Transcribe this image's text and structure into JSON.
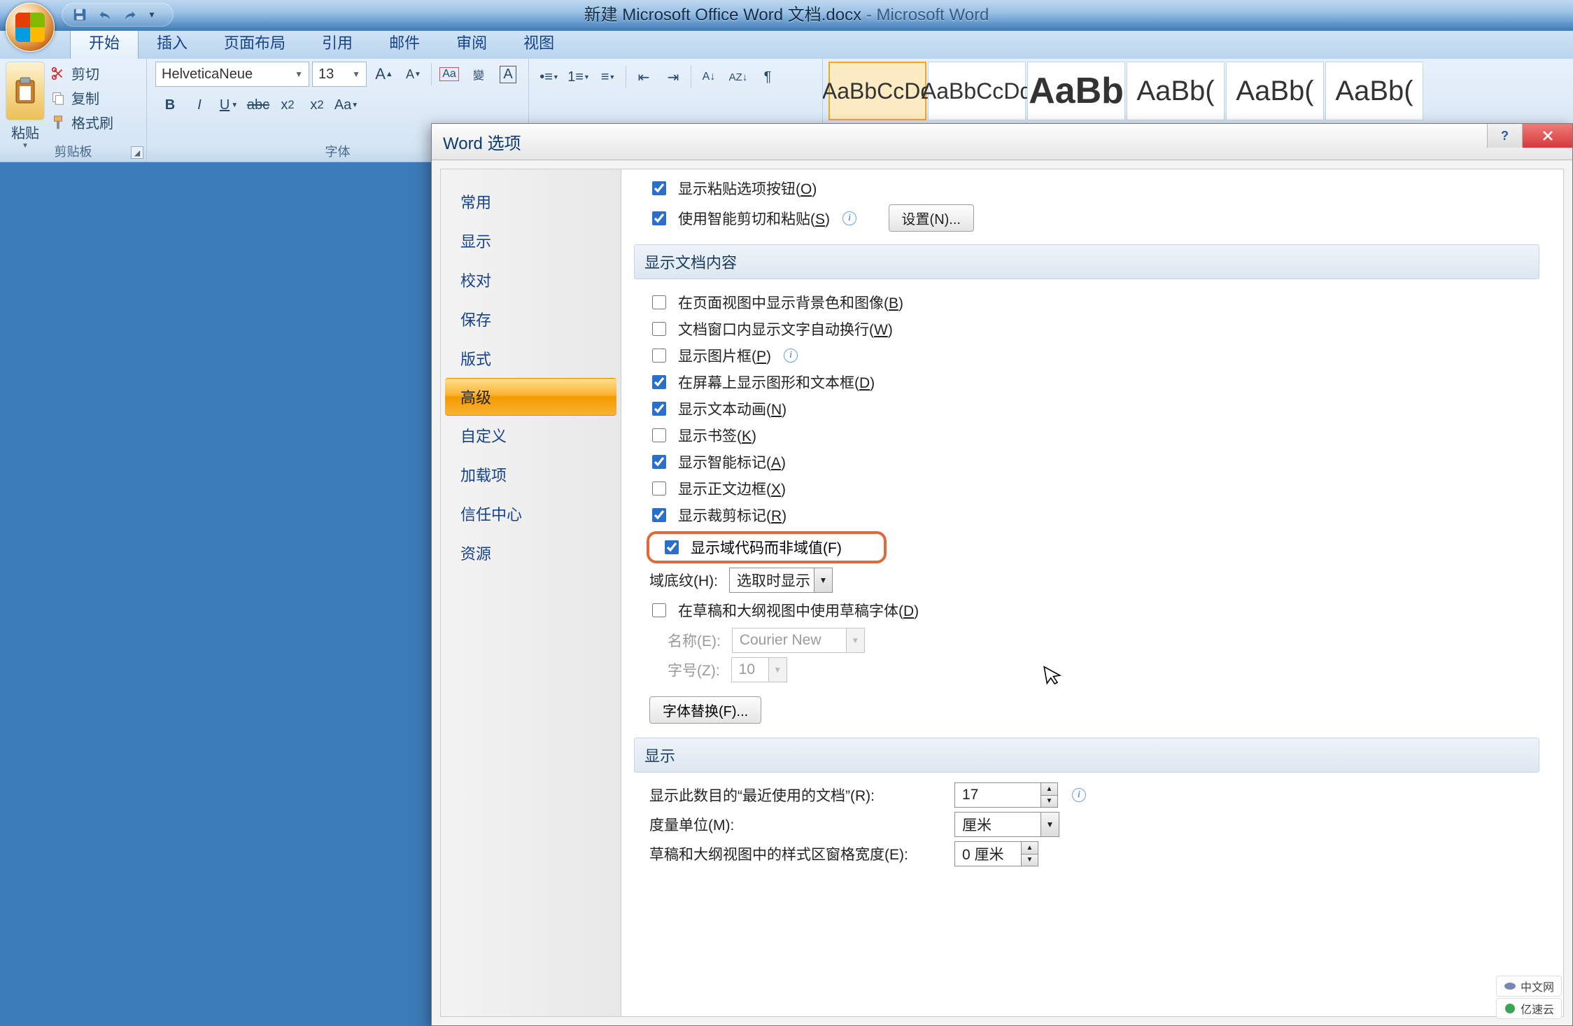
{
  "titlebar": {
    "filename": "新建 Microsoft Office Word 文档.docx",
    "appname": "Microsoft Word"
  },
  "tabs": [
    "开始",
    "插入",
    "页面布局",
    "引用",
    "邮件",
    "审阅",
    "视图"
  ],
  "active_tab": 0,
  "ribbon": {
    "clipboard": {
      "group_label": "剪贴板",
      "paste": "粘贴",
      "cut": "剪切",
      "copy": "复制",
      "format_painter": "格式刷"
    },
    "font": {
      "group_label": "字体",
      "font_name": "HelveticaNeue",
      "font_size": "13"
    },
    "styles": [
      "AaBbCcDd",
      "AaBbCcDd",
      "AaBb",
      "AaBb(",
      "AaBb(",
      "AaBb("
    ]
  },
  "dialog": {
    "title": "Word 选项",
    "nav": [
      "常用",
      "显示",
      "校对",
      "保存",
      "版式",
      "高级",
      "自定义",
      "加载项",
      "信任中心",
      "资源"
    ],
    "nav_selected": 5,
    "opts": {
      "paste_options": {
        "label_pre": "显示粘贴选项按钮(",
        "u": "O",
        "label_post": ")",
        "checked": true
      },
      "smart_cutpaste": {
        "label_pre": "使用智能剪切和粘贴(",
        "u": "S",
        "label_post": ")",
        "checked": true
      },
      "settings_btn": "设置(N)...",
      "section_doc": "显示文档内容",
      "bg_img": {
        "label_pre": "在页面视图中显示背景色和图像(",
        "u": "B",
        "label_post": ")",
        "checked": false
      },
      "wrap": {
        "label_pre": "文档窗口内显示文字自动换行(",
        "u": "W",
        "label_post": ")",
        "checked": false
      },
      "pic_frame": {
        "label_pre": "显示图片框(",
        "u": "P",
        "label_post": ")",
        "checked": false,
        "info": true
      },
      "draw_text": {
        "label_pre": "在屏幕上显示图形和文本框(",
        "u": "D",
        "label_post": ")",
        "checked": true
      },
      "text_anim": {
        "label_pre": "显示文本动画(",
        "u": "N",
        "label_post": ")",
        "checked": true
      },
      "bookmark": {
        "label_pre": "显示书签(",
        "u": "K",
        "label_post": ")",
        "checked": false
      },
      "smart_tag": {
        "label_pre": "显示智能标记(",
        "u": "A",
        "label_post": ")",
        "checked": true
      },
      "text_border": {
        "label_pre": "显示正文边框(",
        "u": "X",
        "label_post": ")",
        "checked": false
      },
      "crop_marks": {
        "label_pre": "显示裁剪标记(",
        "u": "R",
        "label_post": ")",
        "checked": true
      },
      "field_codes": {
        "label_pre": "显示域代码而非域值(",
        "u": "F",
        "label_post": ")",
        "checked": true
      },
      "field_shading_label": "域底纹(H):",
      "field_shading_value": "选取时显示",
      "draft_font": {
        "label_pre": "在草稿和大纲视图中使用草稿字体(",
        "u": "D",
        "label_post": ")",
        "checked": false
      },
      "draft_name_label": "名称(E):",
      "draft_name_value": "Courier New",
      "draft_size_label": "字号(Z):",
      "draft_size_value": "10",
      "font_sub_btn": "字体替换(F)...",
      "section_disp": "显示",
      "recent_label": "显示此数目的“最近使用的文档”(R):",
      "recent_value": "17",
      "unit_label": "度量单位(M):",
      "unit_value": "厘米",
      "style_area_label": "草稿和大纲视图中的样式区窗格宽度(E):",
      "style_area_value": "0 厘米"
    }
  },
  "watermark": {
    "line1": "中文网",
    "line2": "亿速云"
  }
}
